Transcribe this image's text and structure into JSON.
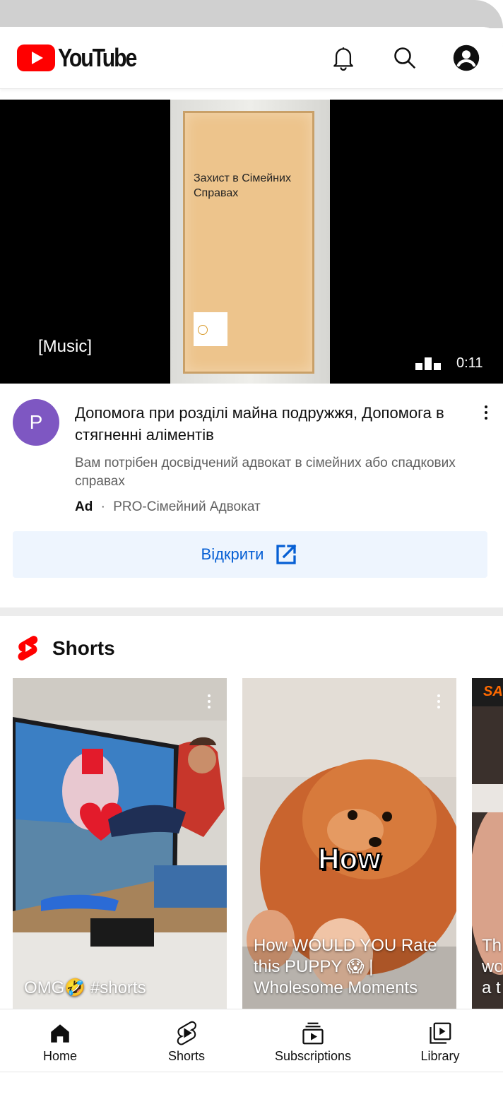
{
  "app": {
    "name": "YouTube"
  },
  "header": {
    "logo_text": "YouTube",
    "icons": [
      "bell-icon",
      "search-icon",
      "account-icon"
    ]
  },
  "video": {
    "poster_title": "Захист в Сімейних Справах",
    "caption": "[Music]",
    "duration": "0:11"
  },
  "ad": {
    "avatar_letter": "P",
    "avatar_color": "#7e57c2",
    "title": "Допомога при розділі майна подружжя, Допомога в стягненні аліментів",
    "description": "Вам потрібен досвідчений адвокат в сімейних або спадкових справах",
    "badge": "Ad",
    "separator": "·",
    "advertiser": "PRO-Сімейний Адвокат",
    "cta_label": "Відкрити",
    "cta_color": "#065fd4"
  },
  "shorts": {
    "title": "Shorts",
    "accent": "#ff0000",
    "items": [
      {
        "title": "OMG🤣 #shorts"
      },
      {
        "overlay_text": "How",
        "title": "How WOULD YOU Rate this PUPPY 😱 | Wholesome Moments"
      },
      {
        "badge": "SA",
        "title": "Th wo a t"
      }
    ]
  },
  "bottom_nav": {
    "items": [
      {
        "label": "Home",
        "icon": "home-icon"
      },
      {
        "label": "Shorts",
        "icon": "shorts-icon"
      },
      {
        "label": "Subscriptions",
        "icon": "subscriptions-icon"
      },
      {
        "label": "Library",
        "icon": "library-icon"
      }
    ]
  }
}
